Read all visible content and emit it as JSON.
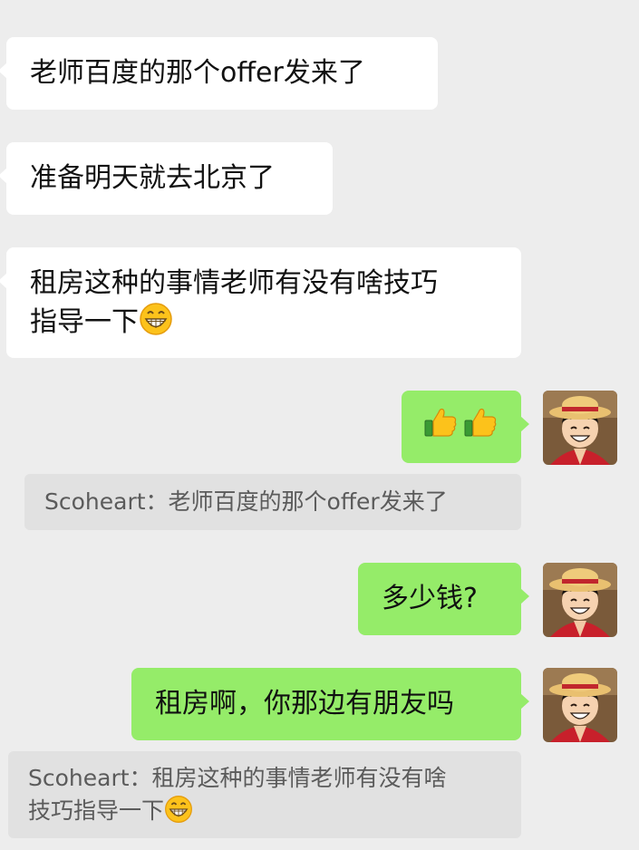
{
  "messages": {
    "m1": "老师百度的那个offer发来了",
    "m2": "准备明天就去北京了",
    "m3_line1": "租房这种的事情老师有没有啥技巧",
    "m3_line2": "指导一下",
    "m5": "多少钱?",
    "m6": "租房啊，你那边有朋友吗"
  },
  "quotes": {
    "q1": "Scoheart：老师百度的那个offer发来了",
    "q2_line1": "Scoheart：租房这种的事情老师有没有啥",
    "q2_line2": "技巧指导一下"
  },
  "icons": {
    "grin": "grinning-face-emoji",
    "thumbs": "thumbs-up-emoji",
    "avatar": "luffy-straw-hat-avatar"
  },
  "colors": {
    "background": "#ededed",
    "incoming_bubble": "#ffffff",
    "outgoing_bubble": "#95ec69",
    "quote_bg": "#e1e1e1",
    "quote_text": "#5b5b5b"
  }
}
